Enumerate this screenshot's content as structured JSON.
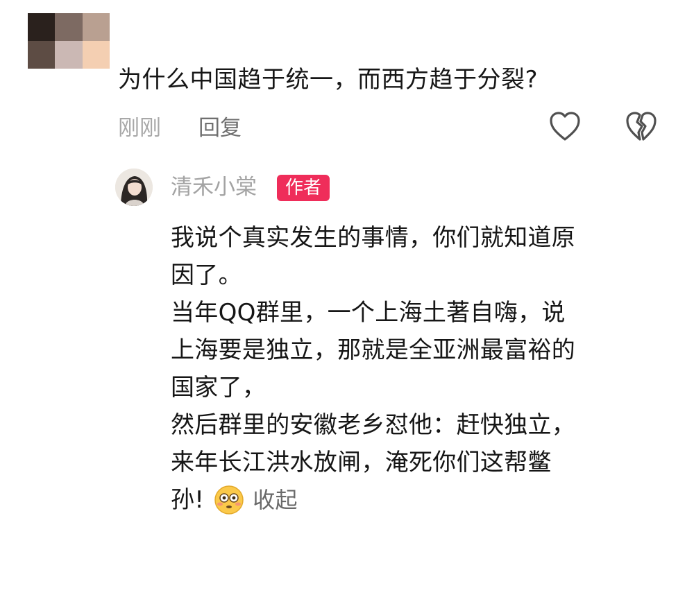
{
  "comment": {
    "text": "为什么中国趋于统一，而西方趋于分裂?",
    "time": "刚刚",
    "reply_label": "回复",
    "like_icon": "heart-outline-icon",
    "dislike_icon": "broken-heart-icon"
  },
  "reply": {
    "username": "清禾小棠",
    "badge": "作者",
    "lines": [
      "我说个真实发生的事情，你们就知道原",
      "因了。",
      "当年QQ群里，一个上海土著自嗨，说",
      "上海要是独立，那就是全亚洲最富裕的",
      "国家了，",
      "然后群里的安徽老乡怼他：赶快独立，",
      "来年长江洪水放闸，淹死你们这帮鳖",
      "孙!"
    ],
    "emoji": "flushed-face-icon",
    "collapse_label": "收起"
  },
  "colors": {
    "badge": "#ef2d5a",
    "meta_text": "#a8a8a8",
    "body_text": "#161616"
  }
}
